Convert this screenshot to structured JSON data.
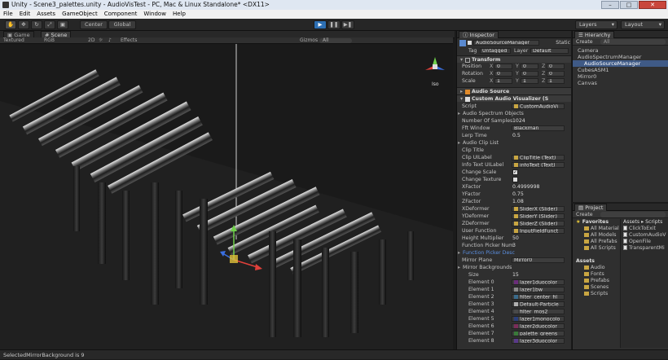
{
  "window": {
    "title": "Unity - Scene3_palettes.unity - AudioVisTest - PC, Mac & Linux Standalone* <DX11>",
    "controls": [
      "–",
      "□",
      "✕"
    ]
  },
  "menu": [
    "File",
    "Edit",
    "Assets",
    "GameObject",
    "Component",
    "Window",
    "Help"
  ],
  "toolbar": {
    "pivot": "Center",
    "space": "Global",
    "layers": "Layers",
    "layout": "Layout"
  },
  "view_tabs": [
    "Game",
    "Scene"
  ],
  "scene_bar": {
    "shading": "Textured",
    "render": "RGB",
    "mode2d": "2D",
    "effects": "Effects",
    "gizmos": "Gizmos",
    "search": "All"
  },
  "gizmo": {
    "label": "Iso",
    "axes": [
      "x",
      "y",
      "z"
    ]
  },
  "inspector": {
    "tab": "Inspector",
    "object_name": "AudioSourceManager",
    "static_label": "Static",
    "tag_label": "Tag",
    "tag": "Untagged",
    "layer_label": "Layer",
    "layer": "Default",
    "transform": {
      "title": "Transform",
      "rows": [
        {
          "label": "Position",
          "x": "0",
          "y": "0",
          "z": "0"
        },
        {
          "label": "Rotation",
          "x": "0",
          "y": "0",
          "z": "0"
        },
        {
          "label": "Scale",
          "x": "1",
          "y": "1",
          "z": "1"
        }
      ]
    },
    "audio_source": "Audio Source",
    "visualizer": "Custom Audio Visualizer (S",
    "fields": [
      {
        "label": "Script",
        "value": "CustomAudioVi",
        "kind": "obj"
      },
      {
        "label": "Audio Spectrum Objects",
        "value": "",
        "kind": "fold"
      },
      {
        "label": "Number Of Samples",
        "value": "1024",
        "kind": "text"
      },
      {
        "label": "Fft Window",
        "value": "Blackman",
        "kind": "field"
      },
      {
        "label": "Lerp Time",
        "value": "0.5",
        "kind": "text"
      },
      {
        "label": "Audio Clip List",
        "value": "",
        "kind": "fold"
      },
      {
        "label": "Clip Title",
        "value": "",
        "kind": "text"
      },
      {
        "label": "Clip UILabel",
        "value": "ClipTitle (Text)",
        "kind": "obj"
      },
      {
        "label": "Info Text UILabel",
        "value": "infoText (Text)",
        "kind": "obj"
      },
      {
        "label": "Change Scale",
        "value": "✓",
        "kind": "check"
      },
      {
        "label": "Change Texture",
        "value": "",
        "kind": "check"
      },
      {
        "label": "XFactor",
        "value": "0.4999998",
        "kind": "text"
      },
      {
        "label": "YFactor",
        "value": "0.75",
        "kind": "text"
      },
      {
        "label": "ZFactor",
        "value": "1.08",
        "kind": "text"
      },
      {
        "label": "XDeformer",
        "value": "SliderX (Slider)",
        "kind": "obj"
      },
      {
        "label": "YDeformer",
        "value": "SliderY (Slider)",
        "kind": "obj"
      },
      {
        "label": "ZDeformer",
        "value": "SliderZ (Slider)",
        "kind": "obj"
      },
      {
        "label": "User Function",
        "value": "InputFieldFunct",
        "kind": "obj"
      },
      {
        "label": "Height Multiplier",
        "value": "50",
        "kind": "text"
      },
      {
        "label": "Function Picker Num",
        "value": "3",
        "kind": "text"
      },
      {
        "label": "Function Picker Desc",
        "value": "",
        "kind": "link"
      },
      {
        "label": "Mirror Plane",
        "value": "Mirror0",
        "kind": "field"
      },
      {
        "label": "Mirror Backgrounds",
        "value": "",
        "kind": "fold"
      },
      {
        "label": "Size",
        "value": "15",
        "kind": "indent"
      },
      {
        "label": "Element 0",
        "value": "lazer1duocolor",
        "kind": "mat",
        "color": "#6a2d7a"
      },
      {
        "label": "Element 1",
        "value": "lazer1bw",
        "kind": "mat",
        "color": "#8a8a8a"
      },
      {
        "label": "Element 2",
        "value": "filter_center_fil",
        "kind": "mat",
        "color": "#3a6b8c"
      },
      {
        "label": "Element 3",
        "value": "Default-Particle",
        "kind": "mat",
        "color": "#b0b0b0"
      },
      {
        "label": "Element 4",
        "value": "filter_mos2",
        "kind": "mat",
        "color": "#4a4a4a"
      },
      {
        "label": "Element 5",
        "value": "lazer1monocolo",
        "kind": "mat",
        "color": "#2b3f7a"
      },
      {
        "label": "Element 6",
        "value": "lazer2duocolor",
        "kind": "mat",
        "color": "#7a2d5a"
      },
      {
        "label": "Element 7",
        "value": "palette_greens",
        "kind": "mat",
        "color": "#3a7a3a"
      },
      {
        "label": "Element 8",
        "value": "lazer3duocolor",
        "kind": "mat",
        "color": "#5a3a8a"
      }
    ]
  },
  "hierarchy": {
    "tab": "Hierarchy",
    "create": "Create",
    "search": "All",
    "items": [
      "Camera",
      "AudioSpectrumManager",
      "AudioSourceManager",
      "CubesASM1",
      "Mirror0",
      "Canvas"
    ],
    "selected_index": 2
  },
  "project": {
    "tab": "Project",
    "create": "Create",
    "breadcrumb": "Assets ▸ Scripts",
    "favorites_label": "Favorites",
    "favorites": [
      "All Material",
      "All Models",
      "All Prefabs",
      "All Scripts"
    ],
    "assets_label": "Assets",
    "folders": [
      "Audio",
      "Fonts",
      "Prefabs",
      "Scenes",
      "Scripts"
    ],
    "files": [
      "ClickToExit",
      "CustomAudioV",
      "OpenFile",
      "TransparentMi"
    ]
  },
  "status": "SelectedMirrorBackground is 9"
}
